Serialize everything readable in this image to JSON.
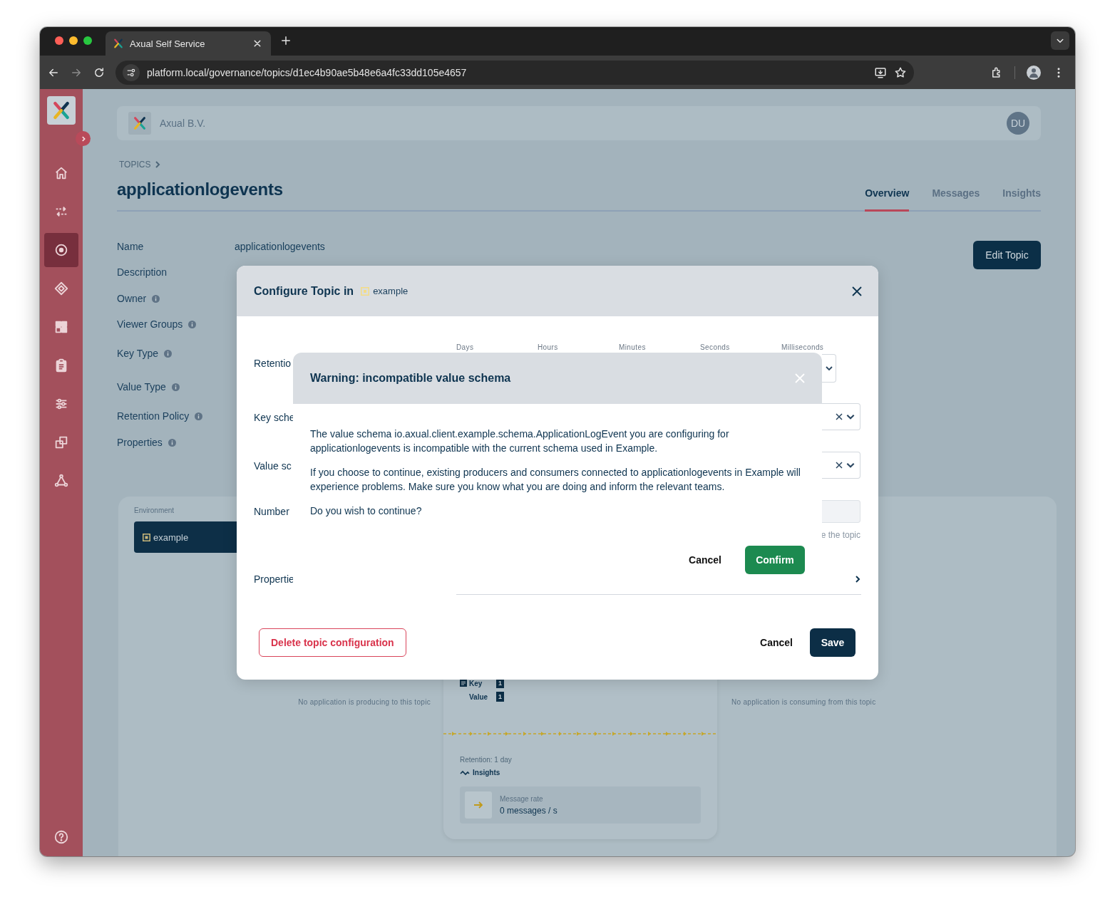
{
  "browser": {
    "tab_title": "Axual Self Service",
    "url": "platform.local/governance/topics/d1ec4b90ae5b48e6a4fc33dd105e4657"
  },
  "sidebar": {
    "items": [
      {
        "kind": "home",
        "selected": false
      },
      {
        "kind": "streams",
        "selected": false
      },
      {
        "kind": "topics",
        "selected": true
      },
      {
        "kind": "schemas",
        "selected": false
      },
      {
        "kind": "apps",
        "selected": false
      },
      {
        "kind": "tasks",
        "selected": false
      },
      {
        "kind": "settings",
        "selected": false
      },
      {
        "kind": "environments",
        "selected": false
      },
      {
        "kind": "network",
        "selected": false
      }
    ]
  },
  "header": {
    "org": "Axual B.V.",
    "avatar": "DU"
  },
  "breadcrumb": "TOPICS",
  "title": "applicationlogevents",
  "tabs": [
    {
      "label": "Overview",
      "selected": true
    },
    {
      "label": "Messages",
      "selected": false
    },
    {
      "label": "Insights",
      "selected": false
    }
  ],
  "details": [
    {
      "label": "Name",
      "info": false,
      "value": "applicationlogevents"
    },
    {
      "label": "Description",
      "info": false
    },
    {
      "label": "Owner",
      "info": true
    },
    {
      "label": "Viewer Groups",
      "info": true
    },
    {
      "label": "Key Type",
      "info": true
    },
    {
      "label": "Value Type",
      "info": true
    },
    {
      "label": "Retention Policy",
      "info": true
    },
    {
      "label": "Properties",
      "info": true
    }
  ],
  "edit_button": "Edit Topic",
  "environment": {
    "label": "Environment",
    "items": [
      {
        "label": "example",
        "selected": true
      }
    ]
  },
  "producers_note": "No application is producing to this topic",
  "consumers_note": "No application is consuming from this topic",
  "topic_card": {
    "schemas": [
      {
        "label": "Key",
        "count": "1"
      },
      {
        "label": "Value",
        "count": "1"
      }
    ],
    "retention": "Retention: 1 day",
    "insights": "Insights",
    "rate_label": "Message rate",
    "rate_value": "0 messages / s"
  },
  "config_dialog": {
    "title": "Configure Topic in",
    "environment": "example",
    "duration_units": [
      "Days",
      "Hours",
      "Minutes",
      "Seconds",
      "Milliseconds"
    ],
    "fields": [
      "Retentio",
      "Key sche",
      "Value sc",
      "Number",
      "Propertie"
    ],
    "hint": "e the topic",
    "delete_button": "Delete topic configuration",
    "cancel_button": "Cancel",
    "save_button": "Save"
  },
  "warning_dialog": {
    "title": "Warning: incompatible value schema",
    "paragraphs": [
      "The value schema io.axual.client.example.schema.ApplicationLogEvent you are configuring for applicationlogevents is incompatible with the current schema used in Example.",
      "If you choose to continue, existing producers and consumers connected to applicationlogevents in Example will experience problems. Make sure you know what you are doing and inform the relevant teams.",
      "Do you wish to continue?"
    ],
    "cancel_button": "Cancel",
    "confirm_button": "Confirm"
  }
}
